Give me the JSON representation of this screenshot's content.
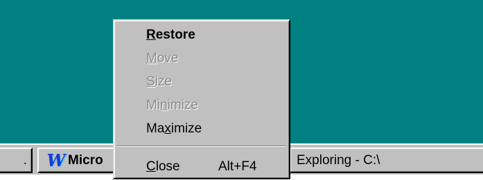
{
  "colors": {
    "desktop": "#008080",
    "face": "#c0c0c0",
    "disabled_text": "#8a8a8a"
  },
  "taskbar": {
    "partial_button_label": ".",
    "word_button": {
      "icon": "word-icon",
      "icon_glyph": "W",
      "label": "Micro"
    },
    "explorer_button_label": "Exploring - C:\\"
  },
  "system_menu": {
    "restore": {
      "accel": "R",
      "rest": "estore",
      "enabled": true
    },
    "move": {
      "accel": "M",
      "rest": "ove",
      "enabled": false
    },
    "size": {
      "accel": "S",
      "rest": "ize",
      "enabled": false
    },
    "minimize": {
      "pre": "Mi",
      "accel": "n",
      "rest": "imize",
      "enabled": false
    },
    "maximize": {
      "pre": "Ma",
      "accel": "x",
      "rest": "imize",
      "enabled": true
    },
    "close": {
      "accel": "C",
      "rest": "lose",
      "shortcut": "Alt+F4",
      "enabled": true
    }
  }
}
